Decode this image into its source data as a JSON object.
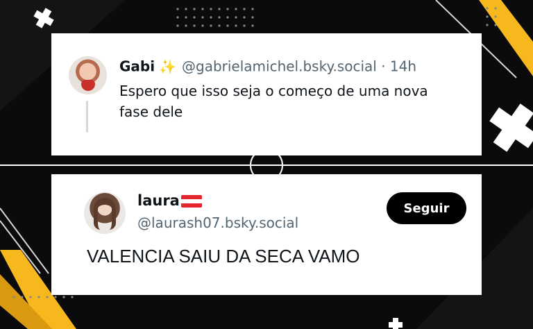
{
  "post_top": {
    "display_name": "Gabi",
    "badge_emoji": "✨",
    "handle": "@gabrielamichel.bsky.social",
    "time": "· 14h",
    "text": "Espero que isso seja o começo de uma nova fase dele"
  },
  "post_bottom": {
    "display_name": "laura",
    "handle": "@laurash07.bsky.social",
    "follow_label": "Seguir",
    "text": "VALENCIA SAIU DA SECA VAMO"
  },
  "colors": {
    "background": "#0b0b0d",
    "accent_yellow": "#f6b81c",
    "card": "#ffffff",
    "handle_gray": "#536471"
  }
}
